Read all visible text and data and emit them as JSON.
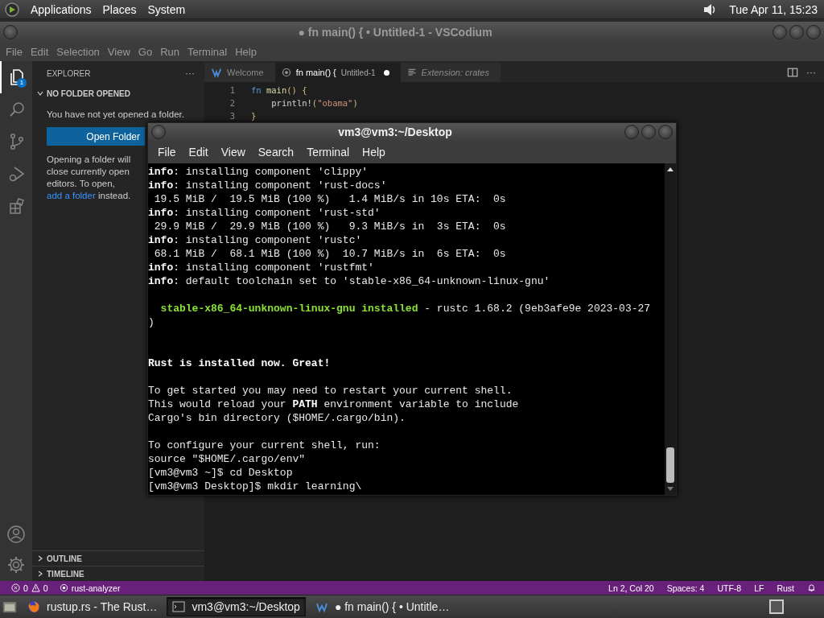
{
  "top_panel": {
    "menus": [
      "Applications",
      "Places",
      "System"
    ],
    "clock": "Tue Apr 11, 15:23"
  },
  "vscodium": {
    "title": "● fn main() { • Untitled-1 - VSCodium",
    "menus": [
      "File",
      "Edit",
      "Selection",
      "View",
      "Go",
      "Run",
      "Terminal",
      "Help"
    ],
    "activity": [
      {
        "kind": "files",
        "selected": true,
        "badge": "1"
      },
      {
        "kind": "search",
        "selected": false
      },
      {
        "kind": "branch",
        "selected": false
      },
      {
        "kind": "debug",
        "selected": false
      },
      {
        "kind": "extensions",
        "selected": false
      }
    ],
    "explorer": {
      "title": "EXPLORER",
      "more": "···",
      "section": "NO FOLDER OPENED",
      "message": "You have not yet opened a folder.",
      "button": "Open Folder",
      "hint_before": "Opening a folder will close currently open editors. To open,",
      "hint_link": "add a folder",
      "hint_after": "instead.",
      "collapsed_sections": [
        "OUTLINE",
        "TIMELINE"
      ]
    },
    "tabs": [
      {
        "kind": "welcome",
        "label": "Welcome",
        "selected": false,
        "italic": false
      },
      {
        "kind": "rust",
        "label": "fn main() {",
        "description": "Untitled-1",
        "dirty": true,
        "selected": true,
        "italic": false
      },
      {
        "kind": "extension",
        "label": "Extension: crates",
        "selected": false,
        "italic": true
      }
    ],
    "tab_more": "···",
    "code": [
      {
        "number": "1",
        "tokens": [
          {
            "kind": "keyword",
            "text": "fn"
          },
          {
            "kind": "function",
            "text": " main"
          },
          {
            "kind": "bracket",
            "text": "() {"
          }
        ]
      },
      {
        "number": "2",
        "tokens": [
          {
            "kind": "plain",
            "text": "    println!"
          },
          {
            "kind": "bracket",
            "text": "("
          },
          {
            "kind": "string",
            "text": "\"obama\""
          },
          {
            "kind": "bracket",
            "text": ")"
          }
        ]
      },
      {
        "number": "3",
        "tokens": [
          {
            "kind": "bracket",
            "text": "}"
          }
        ]
      }
    ],
    "status_bar": {
      "errors": "0",
      "warnings": "0",
      "extension": "rust-analyzer",
      "right": [
        "Ln 2, Col 20",
        "Spaces: 4",
        "UTF-8",
        "LF",
        "Rust"
      ]
    }
  },
  "terminal": {
    "title": "vm3@vm3:~/Desktop",
    "menus": [
      "File",
      "Edit",
      "View",
      "Search",
      "Terminal",
      "Help"
    ],
    "lines": [
      {
        "kind": "text",
        "segments": [
          {
            "kind": "bold",
            "text": "info"
          },
          {
            "kind": "plain",
            "text": ": installing component 'clippy'"
          }
        ]
      },
      {
        "kind": "text",
        "segments": [
          {
            "kind": "bold",
            "text": "info"
          },
          {
            "kind": "plain",
            "text": ": installing component 'rust-docs'"
          }
        ]
      },
      {
        "kind": "text",
        "segments": [
          {
            "kind": "plain",
            "text": " 19.5 MiB /  19.5 MiB (100 %)   1.4 MiB/s in 10s ETA:  0s"
          }
        ]
      },
      {
        "kind": "text",
        "segments": [
          {
            "kind": "bold",
            "text": "info"
          },
          {
            "kind": "plain",
            "text": ": installing component 'rust-std'"
          }
        ]
      },
      {
        "kind": "text",
        "segments": [
          {
            "kind": "plain",
            "text": " 29.9 MiB /  29.9 MiB (100 %)   9.3 MiB/s in  3s ETA:  0s"
          }
        ]
      },
      {
        "kind": "text",
        "segments": [
          {
            "kind": "bold",
            "text": "info"
          },
          {
            "kind": "plain",
            "text": ": installing component 'rustc'"
          }
        ]
      },
      {
        "kind": "text",
        "segments": [
          {
            "kind": "plain",
            "text": " 68.1 MiB /  68.1 MiB (100 %)  10.7 MiB/s in  6s ETA:  0s"
          }
        ]
      },
      {
        "kind": "text",
        "segments": [
          {
            "kind": "bold",
            "text": "info"
          },
          {
            "kind": "plain",
            "text": ": installing component 'rustfmt'"
          }
        ]
      },
      {
        "kind": "text",
        "segments": [
          {
            "kind": "bold",
            "text": "info"
          },
          {
            "kind": "plain",
            "text": ": default toolchain set to 'stable-x86_64-unknown-linux-gnu'"
          }
        ]
      },
      {
        "kind": "empty"
      },
      {
        "kind": "text",
        "segments": [
          {
            "kind": "success",
            "text": "  stable-x86_64-unknown-linux-gnu installed"
          },
          {
            "kind": "plain",
            "text": " - rustc 1.68.2 (9eb3afe9e 2023-03-27"
          }
        ]
      },
      {
        "kind": "text",
        "segments": [
          {
            "kind": "plain",
            "text": ")"
          }
        ]
      },
      {
        "kind": "empty"
      },
      {
        "kind": "empty"
      },
      {
        "kind": "text",
        "segments": [
          {
            "kind": "bold",
            "text": "Rust is installed now. Great!"
          }
        ]
      },
      {
        "kind": "empty"
      },
      {
        "kind": "text",
        "segments": [
          {
            "kind": "plain",
            "text": "To get started you may need to restart your current shell."
          }
        ]
      },
      {
        "kind": "text",
        "segments": [
          {
            "kind": "plain",
            "text": "This would reload your "
          },
          {
            "kind": "bold",
            "text": "PATH"
          },
          {
            "kind": "plain",
            "text": " environment variable to include"
          }
        ]
      },
      {
        "kind": "text",
        "segments": [
          {
            "kind": "plain",
            "text": "Cargo's bin directory ($HOME/.cargo/bin)."
          }
        ]
      },
      {
        "kind": "empty"
      },
      {
        "kind": "text",
        "segments": [
          {
            "kind": "plain",
            "text": "To configure your current shell, run:"
          }
        ]
      },
      {
        "kind": "text",
        "segments": [
          {
            "kind": "plain",
            "text": "source \"$HOME/.cargo/env\""
          }
        ]
      },
      {
        "kind": "text",
        "segments": [
          {
            "kind": "plain",
            "text": "[vm3@vm3 ~]$ cd Desktop"
          }
        ]
      },
      {
        "kind": "text",
        "segments": [
          {
            "kind": "plain",
            "text": "[vm3@vm3 Desktop]$ mkdir learning\\"
          }
        ]
      }
    ]
  },
  "taskbar": {
    "items": [
      {
        "kind": "browser",
        "label": "rustup.rs - The Rust…",
        "selected": false
      },
      {
        "kind": "terminal",
        "label": "vm3@vm3:~/Desktop",
        "selected": true
      },
      {
        "kind": "editor",
        "label": "● fn main() { • Untitle…",
        "selected": false
      }
    ]
  }
}
